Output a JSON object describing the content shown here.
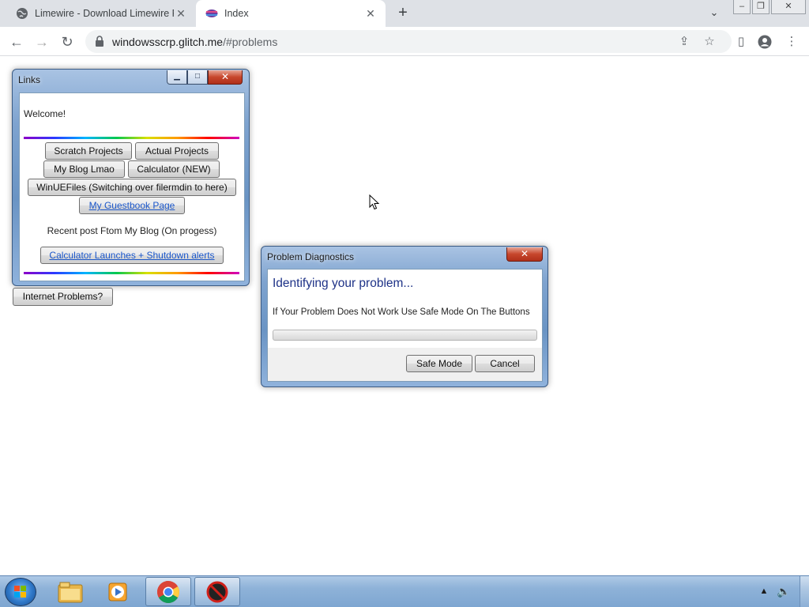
{
  "browser": {
    "tabs": [
      {
        "title": "Limewire - Download Limewire F",
        "active": false
      },
      {
        "title": "Index",
        "active": true
      }
    ],
    "new_tab_label": "+",
    "url_host": "windowsscrp.glitch.me",
    "url_path": "/#problems"
  },
  "links_window": {
    "title": "Links",
    "welcome": "Welcome!",
    "buttons": {
      "scratch": "Scratch Projects",
      "actual": "Actual Projects",
      "blog": "My Blog Lmao",
      "calculator": "Calculator (NEW)",
      "winuefiles": "WinUEFiles (Switching over filermdin to here)",
      "guestbook": "My Guestbook Page"
    },
    "recent_post_heading": "Recent post Ftom My Blog (On progess)",
    "recent_post_link": "Calculator Launches + Shutdown alerts"
  },
  "internet_problems_button": "Internet Problems?",
  "diagnostics_window": {
    "title": "Problem Diagnostics",
    "heading": "Identifying your problem...",
    "message": "If Your Problem Does Not Work Use Safe Mode On The Buttons",
    "progress_percent": 0,
    "safe_mode_button": "Safe Mode",
    "cancel_button": "Cancel"
  },
  "taskbar": {
    "items": [
      "start-orb",
      "explorer",
      "media-player",
      "chrome",
      "blocked-app"
    ],
    "tray": [
      "show-hidden-icons",
      "volume"
    ]
  }
}
